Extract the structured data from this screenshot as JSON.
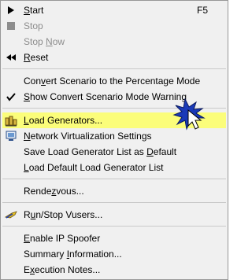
{
  "menu": {
    "items": [
      {
        "pre": "",
        "ul": "S",
        "post": "tart",
        "shortcut": "F5",
        "icon": "play-icon",
        "disabled": false
      },
      {
        "pre": "",
        "ul": "",
        "post": "Stop",
        "shortcut": "",
        "icon": "stop-icon",
        "disabled": true
      },
      {
        "pre": "Stop ",
        "ul": "N",
        "post": "ow",
        "shortcut": "",
        "icon": "",
        "disabled": true
      },
      {
        "pre": "",
        "ul": "R",
        "post": "eset",
        "shortcut": "",
        "icon": "rewind-icon",
        "disabled": false
      },
      {
        "pre": "Con",
        "ul": "v",
        "post": "ert Scenario to the Percentage Mode",
        "shortcut": "",
        "icon": "",
        "disabled": false
      },
      {
        "pre": "",
        "ul": "S",
        "post": "how Convert Scenario Mode Warning",
        "shortcut": "",
        "icon": "checkmark-icon",
        "disabled": false
      },
      {
        "pre": "",
        "ul": "L",
        "post": "oad Generators...",
        "shortcut": "",
        "icon": "load-generators-icon",
        "disabled": false,
        "highlighted": true
      },
      {
        "pre": "",
        "ul": "N",
        "post": "etwork Virtualization Settings",
        "shortcut": "",
        "icon": "network-icon",
        "disabled": false
      },
      {
        "pre": "Save Load Generator List as ",
        "ul": "D",
        "post": "efault",
        "shortcut": "",
        "icon": "",
        "disabled": false
      },
      {
        "pre": "",
        "ul": "L",
        "post": "oad Default Load Generator List",
        "shortcut": "",
        "icon": "",
        "disabled": false
      },
      {
        "pre": "Rende",
        "ul": "z",
        "post": "vous...",
        "shortcut": "",
        "icon": "",
        "disabled": false
      },
      {
        "pre": "R",
        "ul": "u",
        "post": "n/Stop Vusers...",
        "shortcut": "",
        "icon": "vusers-icon",
        "disabled": false
      },
      {
        "pre": "",
        "ul": "E",
        "post": "nable IP Spoofer",
        "shortcut": "",
        "icon": "",
        "disabled": false
      },
      {
        "pre": "Summary ",
        "ul": "I",
        "post": "nformation...",
        "shortcut": "",
        "icon": "",
        "disabled": false
      },
      {
        "pre": "E",
        "ul": "x",
        "post": "ecution Notes...",
        "shortcut": "",
        "icon": "",
        "disabled": false
      }
    ]
  },
  "colors": {
    "menu_background": "#f0f0f0",
    "highlight": "#fbfd7a",
    "disabled_text": "#8d8d8d",
    "cursor_blue": "#1a3ab8"
  }
}
